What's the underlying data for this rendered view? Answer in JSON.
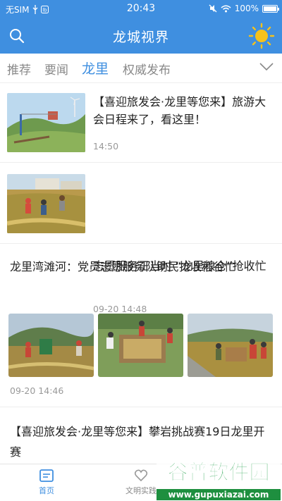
{
  "status_bar": {
    "carrier": "无SIM",
    "time": "20:43",
    "battery": "100%"
  },
  "nav": {
    "title": "龙城视界",
    "search_icon": "search-icon",
    "weather_icon": "sun-icon"
  },
  "tabs": [
    {
      "label": "推荐",
      "active": false
    },
    {
      "label": "要闻",
      "active": false
    },
    {
      "label": "龙里",
      "active": true
    },
    {
      "label": "权威发布",
      "active": false
    }
  ],
  "feed": [
    {
      "title": "【喜迎旅发会·龙里等您来】旅游大会日程来了，看这里！",
      "time": "14:50"
    },
    {
      "title": "志愿服务正当时 “龙里粮仓”抢收忙",
      "time": "09-20 14:48"
    },
    {
      "title": "龙里湾滩河：党员志愿服务队助民抢收稻谷忙",
      "time": "09-20 14:46"
    },
    {
      "title": "【喜迎旅发会·龙里等您来】攀岩挑战赛19日龙里开赛"
    }
  ],
  "tabbar": [
    {
      "label": "首页",
      "active": true
    },
    {
      "label": "文明实践",
      "active": false
    }
  ],
  "watermark": {
    "brand": "谷普软件园",
    "url": "www.gupuxiazai.com"
  },
  "colors": {
    "primary": "#3f8fe0",
    "sun": "#f6c21b"
  }
}
